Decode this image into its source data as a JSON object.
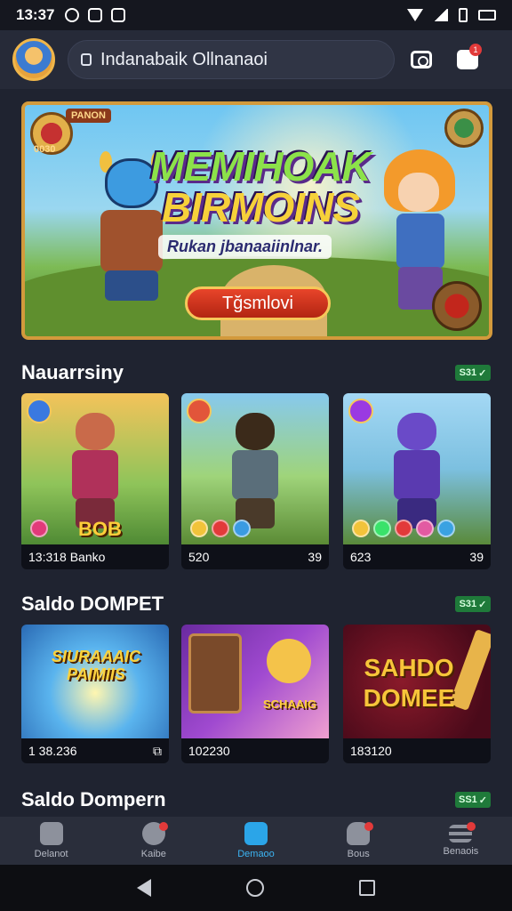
{
  "status": {
    "time": "13:37"
  },
  "header": {
    "search_text": "Indanabaik Ollnanaoi"
  },
  "banner": {
    "badge_ribbon": "PANON",
    "badge_number": "0030",
    "title_line1": "MEMIHOAK",
    "title_line2": "BIRMOINS",
    "subtitle": "Rukan jbanaaiinlnar.",
    "cta_label": "Tğsmlovi"
  },
  "sections": [
    {
      "title": "Nauarrsiny",
      "badge": "S31",
      "cards": [
        {
          "label": "BOB",
          "left": "13:318 Banko",
          "right": ""
        },
        {
          "label": "",
          "left": "520",
          "right": "39"
        },
        {
          "label": "",
          "left": "623",
          "right": "39"
        }
      ]
    },
    {
      "title": "Saldo DOMPET",
      "badge": "S31",
      "cards": [
        {
          "label": "SIURAAAIC PAIMIIS",
          "left": "1 38.236",
          "right": ""
        },
        {
          "label": "SCHAAIG",
          "left": "102230",
          "right": ""
        },
        {
          "label": "SAHDO DOMEE",
          "left": "183120",
          "right": ""
        }
      ]
    },
    {
      "title": "Saldo Dompern",
      "badge": "SS1"
    }
  ],
  "nav": [
    {
      "label": "Delanot",
      "icon": "home-icon"
    },
    {
      "label": "Kaibe",
      "icon": "shield-icon"
    },
    {
      "label": "Demaoo",
      "icon": "wallet-icon"
    },
    {
      "label": "Bous",
      "icon": "hand-icon"
    },
    {
      "label": "Benaois",
      "icon": "menu-icon"
    }
  ],
  "colors": {
    "accent": "#2ba5e8",
    "background": "#1f2330",
    "badge_green": "#1f7a3a"
  }
}
